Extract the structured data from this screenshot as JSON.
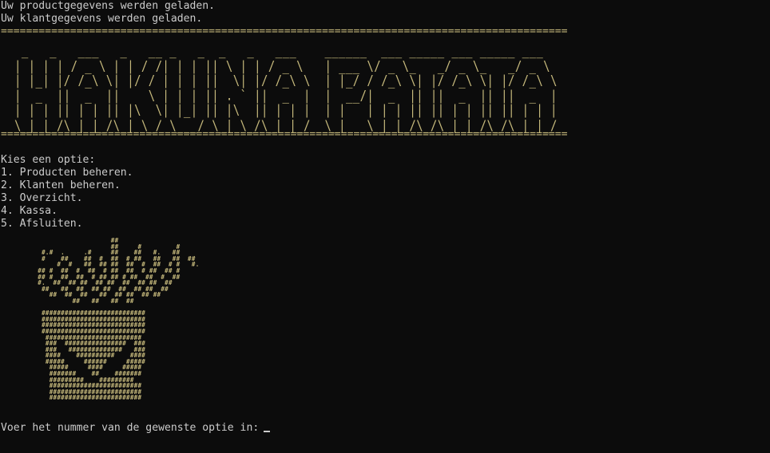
{
  "console": {
    "status_lines": [
      "Uw productgegevens werden geladen.",
      "Uw klantgegevens werden geladen."
    ],
    "separator": "==========================================================================================",
    "banner_art": " _   _   ___   _   __ _   _  _   _   ___    ______  ___ _____ ___ _____ ___  \n| | | | / _ \\ | | / /| | | || \\ | | / _ \\   | ___ \\/ _ \\_   _/ _ \\_   _/ _ \\ \n| |_| |/ /_\\ \\| |/ / | | | ||  \\| |/ /_\\ \\  | |_/ / /_\\ \\| |/ /_\\ \\| |/ /_\\ \\\n|  _  ||  _  ||    \\ | | | || . ` ||  _  |  |  __/|  _  || ||  _  || ||  _  |\n| | | || | | || |\\  \\| |_| || |\\  || | | |  | |   | | | || || | | || || | | |\n\\_| |_/\\_| |_/\\_| \\_/ \\___/ \\_| \\_/\\_| |_/  \\_|   \\_| |_/\\_/\\_| |_/\\_/\\_| |_/",
    "menu": {
      "prompt": "Kies een optie:",
      "options": [
        "1. Producten beheren.",
        "2. Klanten beheren.",
        "3. Overzicht.",
        "4. Kassa.",
        "5. Afsluiten."
      ]
    },
    "fries_art": "                       ##\n                       ##     #         #\n     #.#  .     .#     ##    ##   #.   ##\n     #    ##    ##  #  ##  # ##   ##   ##  ##\n         #  #   ##  ## ##  ##  #  ##  # #   #.\n    ## #  ##  #  ##  # ##  ##  # ##  ## #\n    ## #  ##  ##  # ## ## # ##  ##  #  ##\n    #.  ##  ## ##  ## ##  ##  ## ##  ##\n     ##   ##  ##  ## ##  ##  ## ##  ##\n       ##  ##  ##   ##  ## ##  ## ##\n             ##   ##   ##  ##\n\n     ###########################\n     ###########################\n     ###########################\n     ###########################\n      #########################\n      ###  ################  ###\n      ###   ##############   ###\n      ####    ##########    ####\n      #####     ######     #####\n       #####     ####     #####\n       #######    ##    #######\n       #########    #########\n       ########################\n       ########################\n       ########################",
    "input_prompt": "Voer het nummer van de gewenste optie in:"
  },
  "colors": {
    "background": "#0c0c0c",
    "text": "#cccccc",
    "accent": "#c6b97c"
  }
}
